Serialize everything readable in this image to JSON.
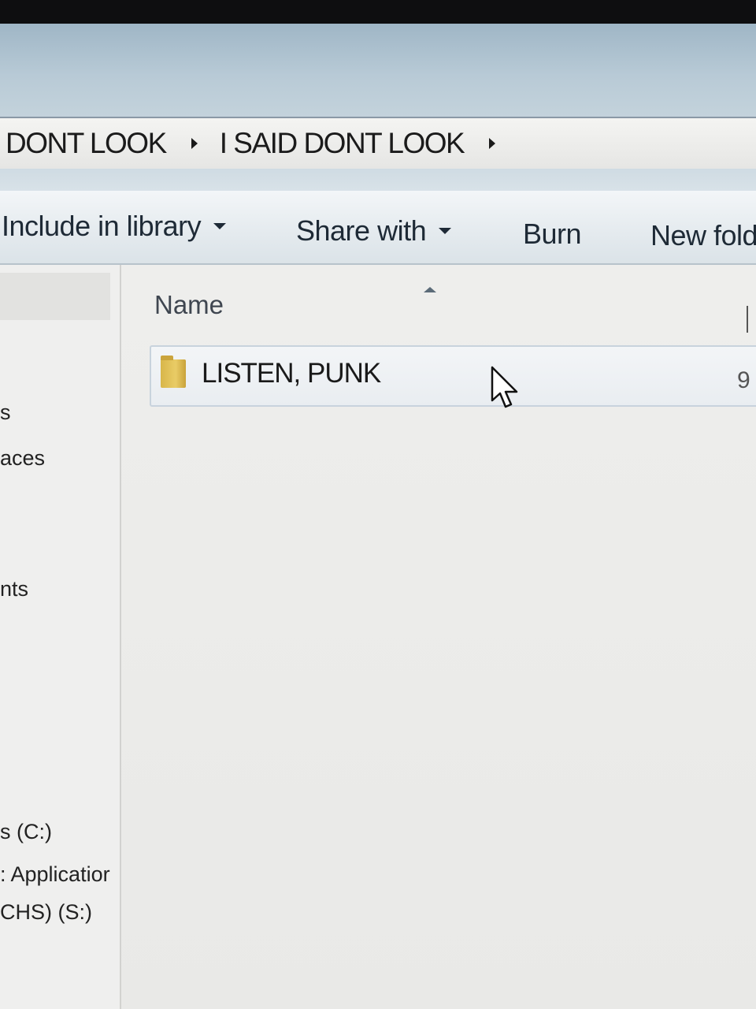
{
  "breadcrumb": {
    "items": [
      "DONT LOOK",
      "I SAID DONT LOOK"
    ]
  },
  "toolbar": {
    "include_in_library": "Include in library",
    "share_with": "Share with",
    "burn": "Burn",
    "new_folder": "New fold"
  },
  "nav_pane": {
    "items": [
      "s",
      "aces",
      "nts",
      "s (C:)",
      ": Applicatior",
      "CHS) (S:)"
    ]
  },
  "file_list": {
    "columns": {
      "name": "Name"
    },
    "rows": [
      {
        "name": "LISTEN, PUNK",
        "date": "9"
      }
    ]
  },
  "icons": {
    "folder": "folder-icon",
    "cursor": "mouse-pointer-icon"
  }
}
